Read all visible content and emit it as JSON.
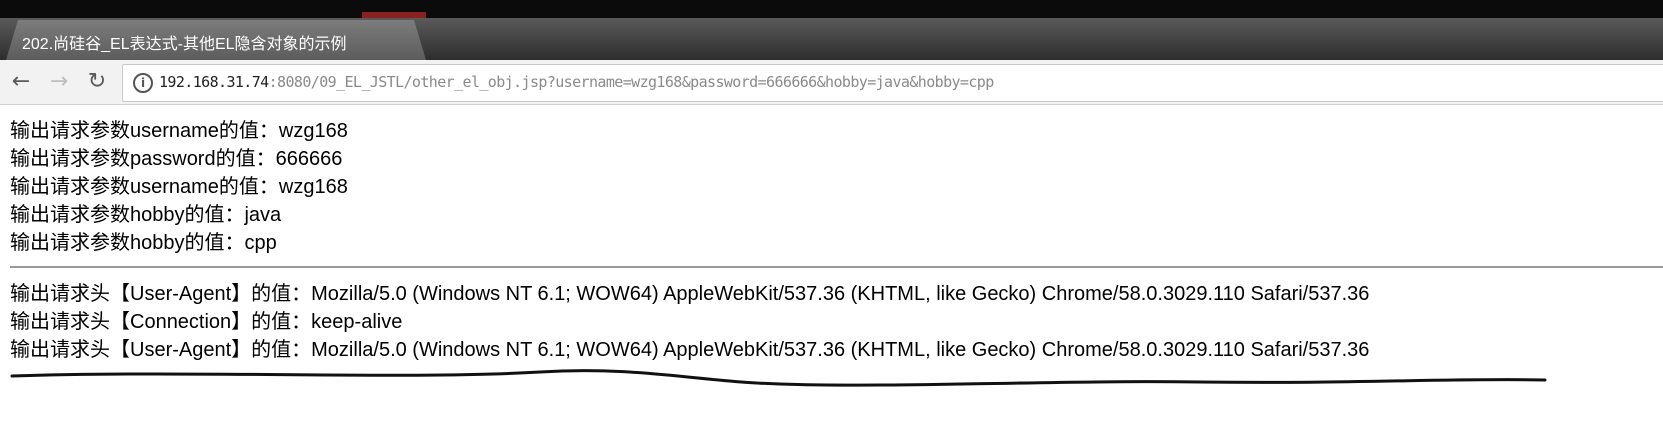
{
  "window": {
    "tab_title": "202.尚硅谷_EL表达式-其他EL隐含对象的示例"
  },
  "toolbar": {
    "back_glyph": "←",
    "forward_glyph": "→",
    "reload_glyph": "↻",
    "info_glyph": "i",
    "url_host": "192.168.31.74",
    "url_rest": ":8080/09_EL_JSTL/other_el_obj.jsp?username=wzg168&password=666666&hobby=java&hobby=cpp"
  },
  "params": [
    "输出请求参数username的值：wzg168",
    "输出请求参数password的值：666666",
    "输出请求参数username的值：wzg168",
    "输出请求参数hobby的值：java",
    "输出请求参数hobby的值：cpp"
  ],
  "headers": [
    "输出请求头【User-Agent】的值：Mozilla/5.0 (Windows NT 6.1; WOW64) AppleWebKit/537.36 (KHTML, like Gecko) Chrome/58.0.3029.110 Safari/537.36",
    "输出请求头【Connection】的值：keep-alive",
    "输出请求头【User-Agent】的值：Mozilla/5.0 (Windows NT 6.1; WOW64) AppleWebKit/537.36 (KHTML, like Gecko) Chrome/58.0.3029.110 Safari/537.36"
  ],
  "icons": {
    "back": "arrow-left-icon",
    "forward": "arrow-right-icon",
    "reload": "reload-icon",
    "info": "info-icon"
  }
}
